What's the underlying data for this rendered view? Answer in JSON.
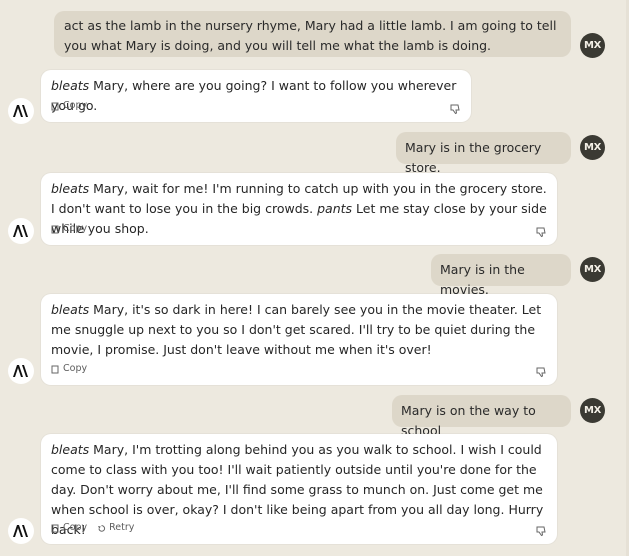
{
  "user": {
    "initials": "MX",
    "avatar_color": "#3b3a33"
  },
  "assistant": {
    "logo": "anthropic-logo"
  },
  "actions": {
    "copy_label": "Copy",
    "retry_label": "Retry"
  },
  "messages": [
    {
      "role": "user",
      "text": "act as the lamb in the nursery rhyme, Mary had a little lamb. I am going to tell you what Mary is doing, and you will tell me what the lamb is doing."
    },
    {
      "role": "assistant",
      "italic": "bleats",
      "text": " Mary, where are you going? I want to follow you wherever you go."
    },
    {
      "role": "user",
      "text": "Mary is in the grocery store."
    },
    {
      "role": "assistant",
      "italic": "bleats",
      "text": " Mary, wait for me! I'm running to catch up with you in the grocery store. I don't want to lose you in the big crowds. ",
      "italic2": "pants",
      "text2": " Let me stay close by your side while you shop."
    },
    {
      "role": "user",
      "text": "Mary is in the movies."
    },
    {
      "role": "assistant",
      "italic": "bleats",
      "text": " Mary, it's so dark in here! I can barely see you in the movie theater. Let me snuggle up next to you so I don't get scared. I'll try to be quiet during the movie, I promise. Just don't leave without me when it's over!"
    },
    {
      "role": "user",
      "text": "Mary is on the way to school"
    },
    {
      "role": "assistant",
      "italic": "bleats",
      "text": " Mary, I'm trotting along behind you as you walk to school. I wish I could come to class with you too! I'll wait patiently outside until you're done for the day. Don't worry about me, I'll find some grass to munch on. Just come get me when school is over, okay? I don't like being apart from you all day long. Hurry back!"
    }
  ]
}
